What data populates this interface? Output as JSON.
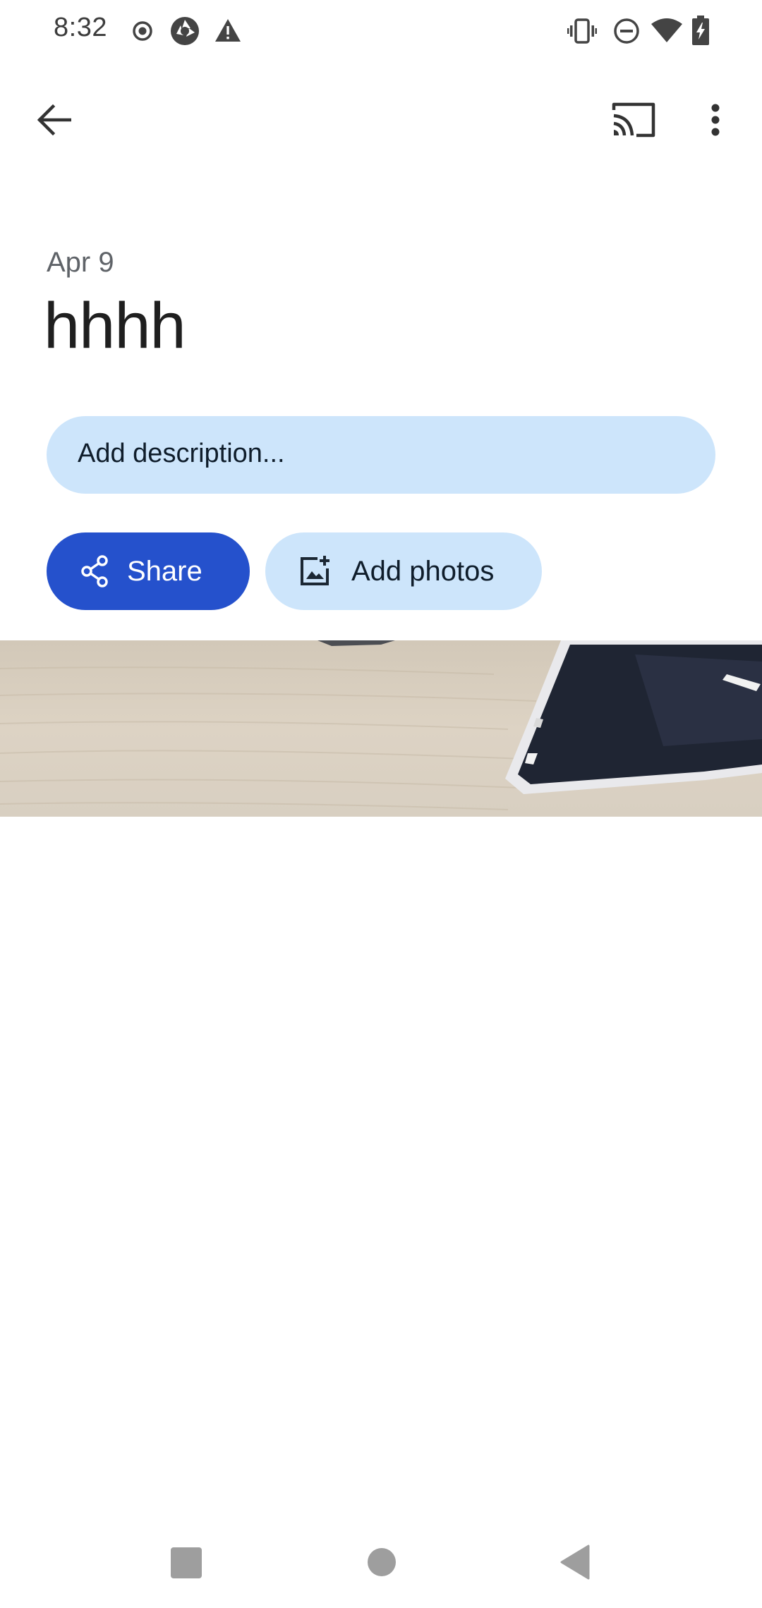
{
  "status_bar": {
    "time": "8:32",
    "left_icons": [
      "record-icon",
      "camera-shutter-icon",
      "warning-icon"
    ],
    "right_icons": [
      "vibrate-icon",
      "do-not-disturb-icon",
      "wifi-icon",
      "battery-charging-icon"
    ]
  },
  "top_bar": {
    "back_icon": "arrow-back-icon",
    "cast_icon": "cast-icon",
    "more_icon": "more-vertical-icon"
  },
  "album": {
    "date": "Apr 9",
    "title": "hhhh",
    "description_placeholder": "Add description..."
  },
  "actions": {
    "share_label": "Share",
    "share_icon": "share-icon",
    "add_photos_label": "Add photos",
    "add_photos_icon": "add-photo-icon"
  },
  "nav_bar": {
    "items": [
      "recents-icon",
      "home-icon",
      "back-triangle-icon"
    ]
  },
  "colors": {
    "primary_button": "#2551cc",
    "tonal_button": "#cde5fb",
    "text_primary": "#1f1f1f",
    "text_secondary": "#5f6368"
  }
}
